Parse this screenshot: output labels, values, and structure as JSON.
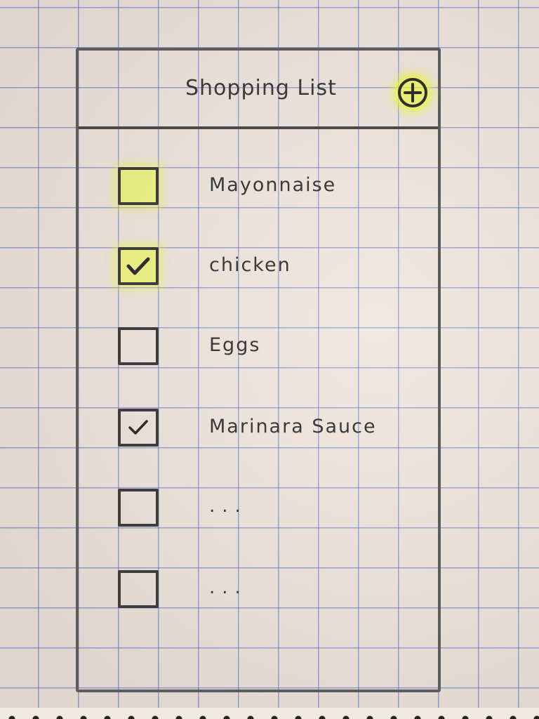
{
  "header": {
    "title": "Shopping List",
    "add_icon": "plus-circle-icon"
  },
  "items": [
    {
      "label": "Mayonnaise",
      "checked": false,
      "highlighted": true
    },
    {
      "label": "chicken",
      "checked": true,
      "highlighted": true
    },
    {
      "label": "Eggs",
      "checked": false,
      "highlighted": false
    },
    {
      "label": "Marinara Sauce",
      "checked": true,
      "highlighted": false
    },
    {
      "label": "...",
      "checked": false,
      "highlighted": false
    },
    {
      "label": "...",
      "checked": false,
      "highlighted": false
    }
  ],
  "colors": {
    "highlight": "#e8f53c",
    "ink": "#3a3a3a",
    "grid": "#5064be"
  }
}
